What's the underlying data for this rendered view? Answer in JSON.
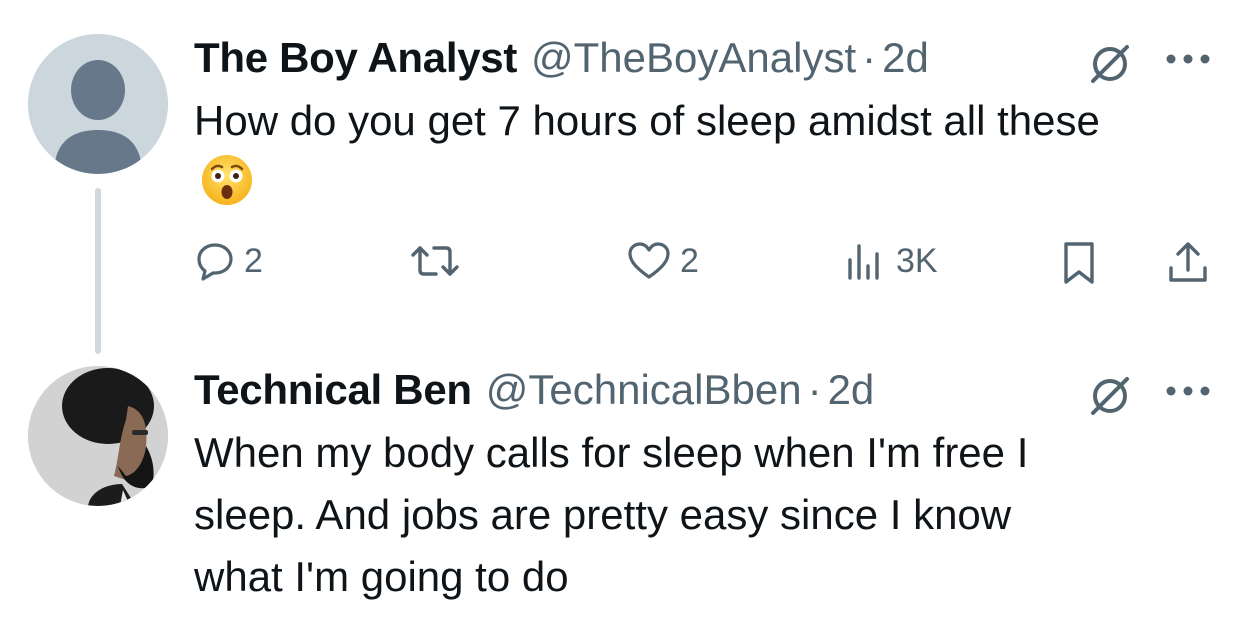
{
  "tweets": [
    {
      "author_name": "The Boy Analyst",
      "handle": "@TheBoyAnalyst",
      "separator": "·",
      "time": "2d",
      "text": "How do you get 7 hours of sleep amidst all these",
      "emoji": "astonished-face",
      "metrics": {
        "replies": "2",
        "likes": "2",
        "views": "3K"
      }
    },
    {
      "author_name": "Technical Ben",
      "handle": "@TechnicalBben",
      "separator": "·",
      "time": "2d",
      "text_lines": [
        "When my body calls for sleep when I'm free I",
        "sleep. And jobs are pretty easy since I know",
        "what I'm going to do"
      ]
    }
  ],
  "icons": {
    "reply": "comment-bubble-icon",
    "retweet": "retweet-icon",
    "like": "heart-icon",
    "views": "bar-chart-icon",
    "bookmark": "bookmark-icon",
    "share": "share-icon",
    "grok": "grok-icon",
    "more": "more-dots-icon"
  },
  "colors": {
    "text": "#0f1419",
    "secondary": "#536471",
    "thread_line": "#cfd9de"
  }
}
